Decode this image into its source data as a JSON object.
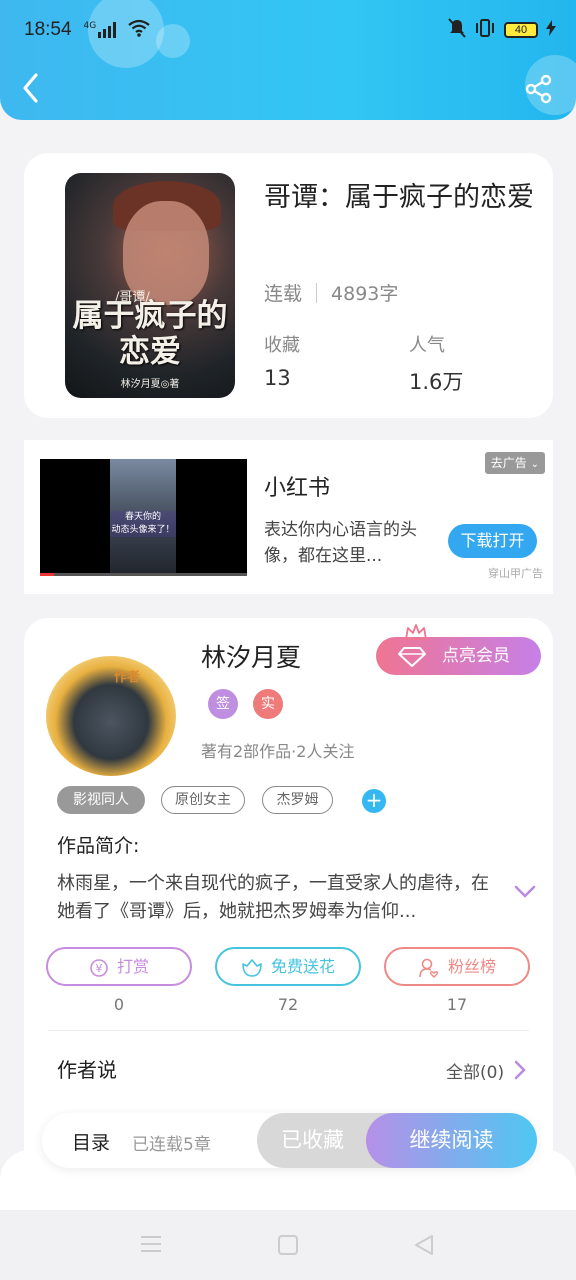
{
  "status_bar": {
    "time": "18:54",
    "network": "4G",
    "battery": "40"
  },
  "book": {
    "title": "哥谭：属于疯子的恋爱",
    "status": "连载",
    "word_count": "4893字",
    "collect_label": "收藏",
    "collect_value": "13",
    "popularity_label": "人气",
    "popularity_value": "1.6万",
    "cover": {
      "subtitle": "/哥谭/",
      "title": "属于疯子的恋爱",
      "author": "林汐月夏◎著"
    }
  },
  "ad": {
    "title": "小红书",
    "description": "表达你内心语言的头像，都在这里...",
    "close_label": "去广告",
    "button_label": "下载打开",
    "source": "穿山甲广告",
    "video_caption": "春天你的\n动态头像来了！"
  },
  "author": {
    "name": "林汐月夏",
    "avatar_tag": "作者",
    "vip_label": "点亮会员",
    "badges": [
      "签",
      "实"
    ],
    "works_info": "著有2部作品·2人关注",
    "tags": [
      "影视同人",
      "原创女主",
      "杰罗姆"
    ],
    "intro_label": "作品简介:",
    "intro_text": "林雨星，一个来自现代的疯子，一直受家人的虐待，在她看了《哥谭》后，她就把杰罗姆奉为信仰...",
    "actions": [
      {
        "label": "打赏",
        "count": "0",
        "color": "#c78be0"
      },
      {
        "label": "免费送花",
        "count": "72",
        "color": "#45c3e0"
      },
      {
        "label": "粉丝榜",
        "count": "17",
        "color": "#ee8a86"
      }
    ],
    "says_label": "作者说",
    "all_label": "全部(0)"
  },
  "bottom_bar": {
    "toc_label": "目录",
    "chapters_label": "已连载5章",
    "collected_label": "已收藏",
    "continue_label": "继续阅读"
  }
}
